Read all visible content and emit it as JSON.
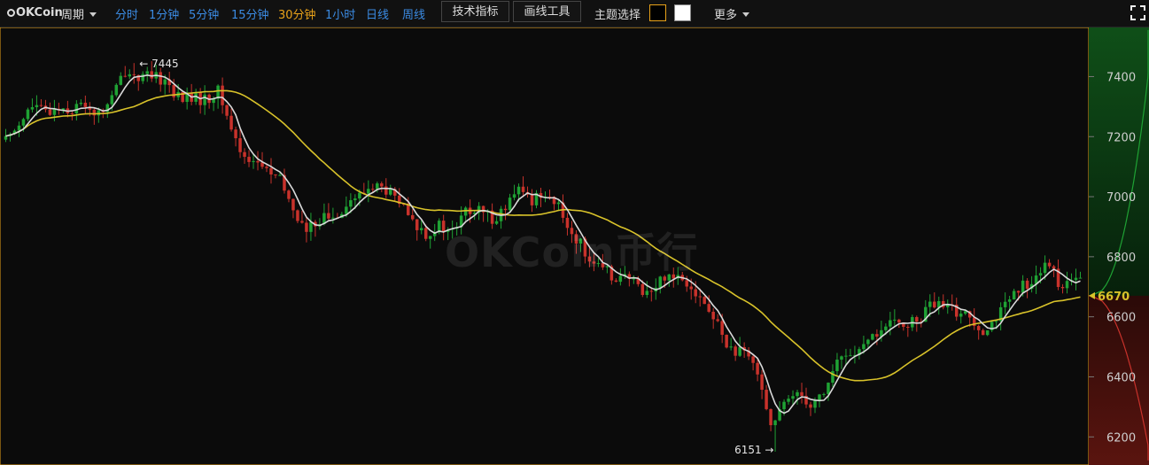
{
  "toolbar": {
    "logo": "OKCoin",
    "period_label": "周期",
    "intervals": [
      {
        "label": "分时",
        "active": false
      },
      {
        "label": "1分钟",
        "active": false
      },
      {
        "label": "5分钟",
        "active": false
      },
      {
        "label": "15分钟",
        "active": false
      },
      {
        "label": "30分钟",
        "active": true
      },
      {
        "label": "1小时",
        "active": false
      },
      {
        "label": "日线",
        "active": false
      },
      {
        "label": "周线",
        "active": false
      }
    ],
    "indicators_button": "技术指标",
    "drawing_button": "画线工具",
    "theme_label": "主题选择",
    "theme_colors": [
      "#000000",
      "#ffffff"
    ],
    "more_label": "更多"
  },
  "watermark": "OKCoin币行",
  "colors": {
    "up": "#1fa234",
    "down": "#c8322b",
    "ma_fast": "#d9d9d9",
    "ma_slow": "#d8c22a",
    "accent": "#e8a21a",
    "link": "#3b8be3"
  },
  "chart_data": {
    "type": "candlestick",
    "interval": "30分钟",
    "y_axis_ticks": [
      7400,
      7200,
      7000,
      6800,
      6600,
      6400,
      6200
    ],
    "ylim": [
      6130,
      7540
    ],
    "high_label": "7445",
    "low_label": "6151",
    "current_price_label": "6670",
    "high": 7445,
    "low": 6151,
    "last": 6670,
    "close_path": [
      [
        0,
        7190
      ],
      [
        3,
        7250
      ],
      [
        6,
        7300
      ],
      [
        9,
        7280
      ],
      [
        12,
        7300
      ],
      [
        15,
        7290
      ],
      [
        18,
        7310
      ],
      [
        21,
        7270
      ],
      [
        24,
        7330
      ],
      [
        27,
        7420
      ],
      [
        30,
        7400
      ],
      [
        33,
        7395
      ],
      [
        36,
        7390
      ],
      [
        39,
        7330
      ],
      [
        42,
        7330
      ],
      [
        45,
        7320
      ],
      [
        48,
        7350
      ],
      [
        50,
        7270
      ],
      [
        53,
        7150
      ],
      [
        56,
        7120
      ],
      [
        59,
        7090
      ],
      [
        62,
        7050
      ],
      [
        65,
        6960
      ],
      [
        68,
        6880
      ],
      [
        71,
        6930
      ],
      [
        74,
        6930
      ],
      [
        77,
        6980
      ],
      [
        80,
        7000
      ],
      [
        83,
        7040
      ],
      [
        86,
        7020
      ],
      [
        89,
        6980
      ],
      [
        92,
        6910
      ],
      [
        95,
        6880
      ],
      [
        98,
        6900
      ],
      [
        101,
        6880
      ],
      [
        104,
        6950
      ],
      [
        107,
        6950
      ],
      [
        110,
        6930
      ],
      [
        113,
        6960
      ],
      [
        116,
        7020
      ],
      [
        119,
        6990
      ],
      [
        122,
        7020
      ],
      [
        125,
        6960
      ],
      [
        128,
        6880
      ],
      [
        131,
        6820
      ],
      [
        134,
        6760
      ],
      [
        137,
        6740
      ],
      [
        140,
        6730
      ],
      [
        143,
        6700
      ],
      [
        146,
        6680
      ],
      [
        149,
        6740
      ],
      [
        152,
        6740
      ],
      [
        155,
        6710
      ],
      [
        158,
        6640
      ],
      [
        161,
        6570
      ],
      [
        164,
        6490
      ],
      [
        167,
        6470
      ],
      [
        170,
        6430
      ],
      [
        173,
        6240
      ],
      [
        176,
        6300
      ],
      [
        179,
        6360
      ],
      [
        182,
        6310
      ],
      [
        185,
        6350
      ],
      [
        188,
        6450
      ],
      [
        191,
        6480
      ],
      [
        194,
        6490
      ],
      [
        197,
        6550
      ],
      [
        200,
        6570
      ],
      [
        203,
        6580
      ],
      [
        206,
        6580
      ],
      [
        209,
        6640
      ],
      [
        212,
        6630
      ],
      [
        215,
        6620
      ],
      [
        218,
        6600
      ],
      [
        221,
        6560
      ],
      [
        224,
        6600
      ],
      [
        227,
        6650
      ],
      [
        230,
        6700
      ],
      [
        233,
        6740
      ],
      [
        236,
        6770
      ],
      [
        238,
        6720
      ],
      [
        240,
        6700
      ],
      [
        242,
        6720
      ],
      [
        243,
        6790
      ]
    ],
    "candle_count": 244,
    "ma_windows": [
      5,
      30
    ]
  }
}
